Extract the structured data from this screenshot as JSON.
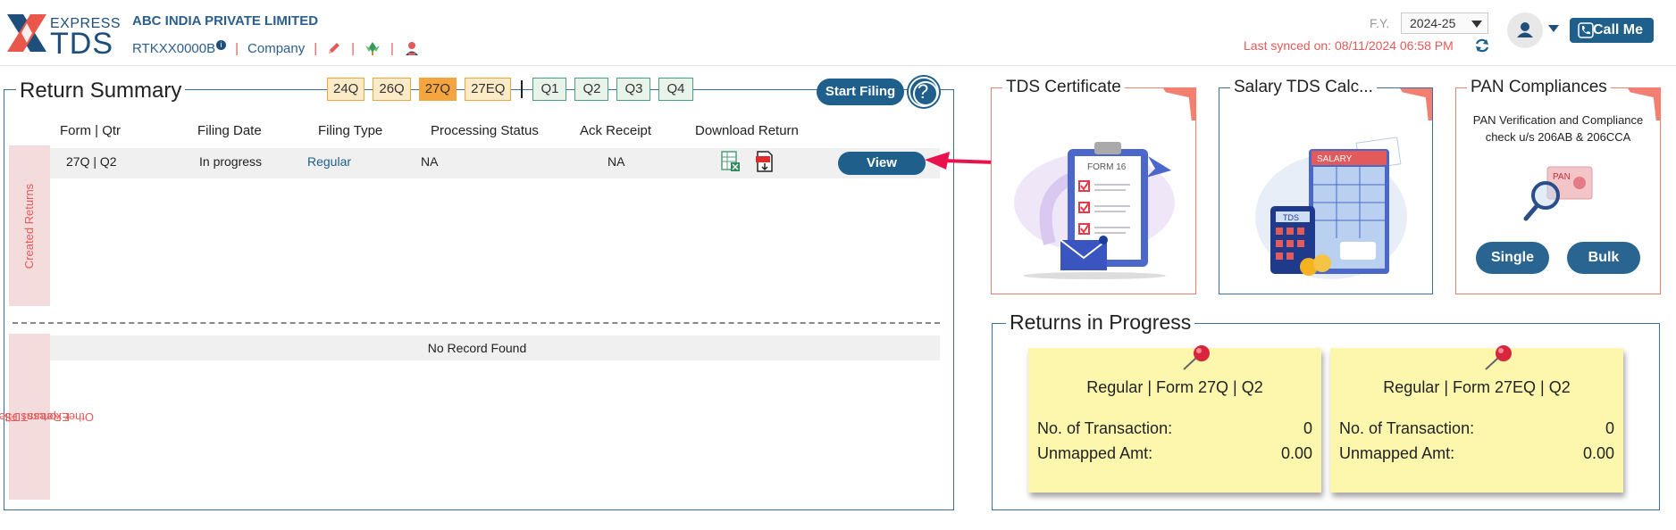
{
  "header": {
    "logo_top": "EXPRESS",
    "logo_bottom": "TDS",
    "company_name": "ABC INDIA PRIVATE LIMITED",
    "tan": "RTKXX0000B",
    "entity_type": "Company",
    "fy_label": "F.Y.",
    "fy_value": "2024-25",
    "sync_text": "Last synced on: 08/11/2024 06:58 PM",
    "call_me": "Call Me"
  },
  "return_summary": {
    "title": "Return Summary",
    "form_tabs": [
      "24Q",
      "26Q",
      "27Q",
      "27EQ"
    ],
    "active_form": "27Q",
    "quarter_tabs": [
      "Q1",
      "Q2",
      "Q3",
      "Q4"
    ],
    "start_filing": "Start Filing",
    "columns": {
      "form_qtr": "Form | Qtr",
      "filing_date": "Filing Date",
      "filing_type": "Filing Type",
      "processing_status": "Processing Status",
      "ack_receipt": "Ack Receipt",
      "download_return": "Download Return"
    },
    "created_label": "Created Returns",
    "rows": [
      {
        "form_qtr": "27Q | Q2",
        "filing_date": "In progress",
        "filing_type": "Regular",
        "processing_status": "NA",
        "ack_receipt": "NA",
        "action": "View"
      }
    ],
    "other_label_line1": "Other Returns Filed outside",
    "other_label_line2": "ExpressTDS",
    "no_record": "No Record Found"
  },
  "cards": {
    "tds_certificate": {
      "title": "TDS Certificate",
      "illustration_text": "FORM 16"
    },
    "salary_calc": {
      "title": "Salary TDS Calc...",
      "illustration_text": "SALARY",
      "badge": "TDS"
    },
    "pan": {
      "title": "PAN Compliances",
      "description": "PAN Verification and Compliance check u/s 206AB & 206CCA",
      "illustration_text": "PAN",
      "single": "Single",
      "bulk": "Bulk"
    }
  },
  "returns_in_progress": {
    "title": "Returns in Progress",
    "items": [
      {
        "title": "Regular | Form 27Q | Q2",
        "txn_label": "No. of Transaction:",
        "txn_value": "0",
        "amt_label": "Unmapped Amt:",
        "amt_value": "0.00"
      },
      {
        "title": "Regular | Form 27EQ | Q2",
        "txn_label": "No. of Transaction:",
        "txn_value": "0",
        "amt_label": "Unmapped Amt:",
        "amt_value": "0.00"
      }
    ]
  },
  "colors": {
    "primary": "#1e5f8c",
    "accent_red": "#e35a5a",
    "form_tab_orange": "#f6a43d",
    "quarter_tab_green": "#4da07e",
    "progress_card": "#fdf7ae"
  },
  "icons": [
    "info-icon",
    "edit-icon",
    "leaf-icon",
    "user-settings-icon",
    "sync-icon",
    "user-icon",
    "phone-icon",
    "help-icon",
    "excel-download-icon",
    "pdf-download-icon",
    "pushpin-icon"
  ]
}
